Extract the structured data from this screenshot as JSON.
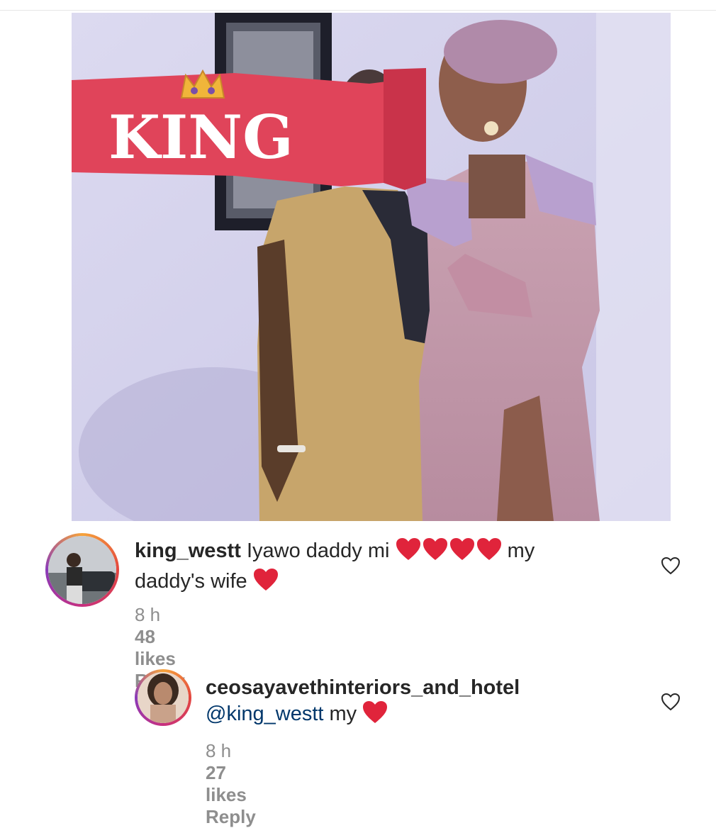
{
  "photo": {
    "banner_text": "KING"
  },
  "comments": [
    {
      "username": "king_westt",
      "text_line1": "Iyawo daddy mi",
      "text_line1_tail": "my",
      "text_line2": "daddy's wife",
      "time": "8 h",
      "likes": "48 likes",
      "reply": "Reply",
      "hearts_line1": 4,
      "hearts_line2": 1
    },
    {
      "username": "ceosayavethinteriors_and_hotel",
      "mention": "@king_westt",
      "text": "my",
      "time": "8 h",
      "likes": "27 likes",
      "reply": "Reply",
      "hearts": 1
    }
  ],
  "colors": {
    "heart_red": "#e0243b",
    "meta_gray": "#8e8e8e",
    "mention_blue": "#00376b",
    "banner_red": "#e0445a"
  },
  "icons": [
    "heart-outline-icon",
    "red-heart-emoji",
    "crown-icon"
  ]
}
